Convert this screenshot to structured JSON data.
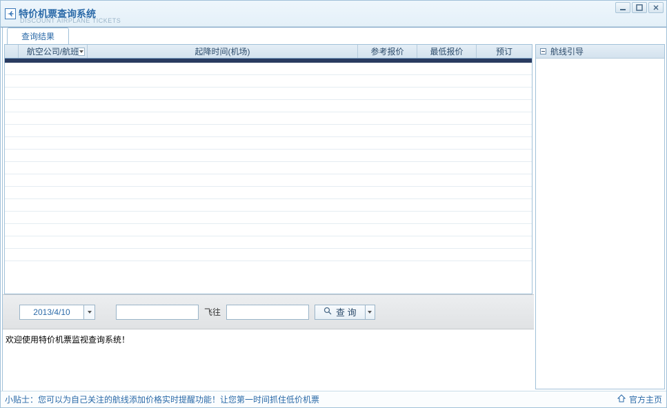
{
  "window": {
    "title": "特价机票查询系统",
    "subtitle": "DISCOUNT AIRPLANE TICKETS"
  },
  "tabs": {
    "results": "查询结果"
  },
  "grid": {
    "headers": {
      "airline": "航空公司/航班",
      "time": "起降时间(机场)",
      "ref_price": "参考报价",
      "low_price": "最低报价",
      "book": "预订"
    }
  },
  "controls": {
    "date_value": "2013/4/10",
    "from_value": "",
    "to_label": "飞往",
    "to_value": "",
    "search_label": "查 询"
  },
  "status": {
    "welcome": "欢迎使用特价机票监视查询系统！"
  },
  "right_panel": {
    "title": "航线引导"
  },
  "footer": {
    "tips_label": "小贴士：",
    "tips_text": "您可以为自己关注的航线添加价格实时提醒功能！让您第一时间抓住低价机票",
    "official_link": "官方主页"
  }
}
